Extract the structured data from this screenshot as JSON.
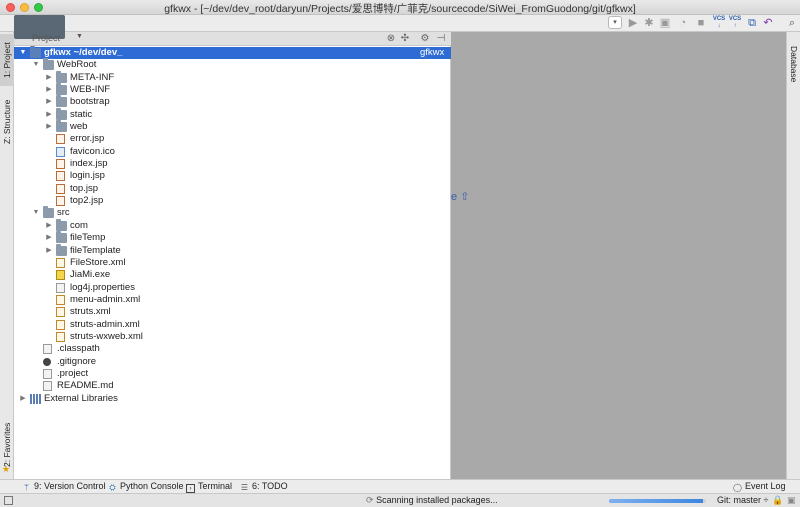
{
  "window": {
    "title": "gfkwx - [~/dev/dev_root/daryun/Projects/爱思博特/广菲克/sourcecode/SiWei_FromGuodong/git/gfkwx]"
  },
  "left_stripe": {
    "tabs": [
      {
        "label": "1: Project",
        "icon": "folder-icon"
      },
      {
        "label": "Z: Structure",
        "icon": "structure-icon"
      },
      {
        "label": "2: Favorites",
        "icon": "star-icon"
      }
    ]
  },
  "right_stripe": {
    "tabs": [
      {
        "label": "Database",
        "icon": "database-icon"
      }
    ]
  },
  "project_panel": {
    "header_label": "Project",
    "tree": [
      {
        "label": "gfkwx  ~/dev/dev_",
        "depth": 0,
        "arrow": "expanded",
        "icon": "folder-blue",
        "selected": true,
        "suffix": "gfkwx"
      },
      {
        "label": "WebRoot",
        "depth": 1,
        "arrow": "expanded",
        "icon": "folder"
      },
      {
        "label": "META-INF",
        "depth": 2,
        "arrow": "collapsed",
        "icon": "folder"
      },
      {
        "label": "WEB-INF",
        "depth": 2,
        "arrow": "collapsed",
        "icon": "folder"
      },
      {
        "label": "bootstrap",
        "depth": 2,
        "arrow": "collapsed",
        "icon": "folder"
      },
      {
        "label": "static",
        "depth": 2,
        "arrow": "collapsed",
        "icon": "folder"
      },
      {
        "label": "web",
        "depth": 2,
        "arrow": "collapsed",
        "icon": "folder"
      },
      {
        "label": "error.jsp",
        "depth": 2,
        "arrow": "none",
        "icon": "file-jsp"
      },
      {
        "label": "favicon.ico",
        "depth": 2,
        "arrow": "none",
        "icon": "file-ico"
      },
      {
        "label": "index.jsp",
        "depth": 2,
        "arrow": "none",
        "icon": "file-jsp"
      },
      {
        "label": "login.jsp",
        "depth": 2,
        "arrow": "none",
        "icon": "file-jsp"
      },
      {
        "label": "top.jsp",
        "depth": 2,
        "arrow": "none",
        "icon": "file-jsp"
      },
      {
        "label": "top2.jsp",
        "depth": 2,
        "arrow": "none",
        "icon": "file-jsp"
      },
      {
        "label": "src",
        "depth": 1,
        "arrow": "expanded",
        "icon": "folder"
      },
      {
        "label": "com",
        "depth": 2,
        "arrow": "collapsed",
        "icon": "folder"
      },
      {
        "label": "fileTemp",
        "depth": 2,
        "arrow": "collapsed",
        "icon": "folder"
      },
      {
        "label": "fileTemplate",
        "depth": 2,
        "arrow": "collapsed",
        "icon": "folder"
      },
      {
        "label": "FileStore.xml",
        "depth": 2,
        "arrow": "none",
        "icon": "file-xml"
      },
      {
        "label": "JiaMi.exe",
        "depth": 2,
        "arrow": "none",
        "icon": "file-exe"
      },
      {
        "label": "log4j.properties",
        "depth": 2,
        "arrow": "none",
        "icon": "file-gen"
      },
      {
        "label": "menu-admin.xml",
        "depth": 2,
        "arrow": "none",
        "icon": "file-xml"
      },
      {
        "label": "struts.xml",
        "depth": 2,
        "arrow": "none",
        "icon": "file-xml"
      },
      {
        "label": "struts-admin.xml",
        "depth": 2,
        "arrow": "none",
        "icon": "file-xml"
      },
      {
        "label": "struts-wxweb.xml",
        "depth": 2,
        "arrow": "none",
        "icon": "file-xml"
      },
      {
        "label": ".classpath",
        "depth": 1,
        "arrow": "none",
        "icon": "file-gen"
      },
      {
        "label": ".gitignore",
        "depth": 1,
        "arrow": "none",
        "icon": "file-git"
      },
      {
        "label": ".project",
        "depth": 1,
        "arrow": "none",
        "icon": "file-gen"
      },
      {
        "label": "README.md",
        "depth": 1,
        "arrow": "none",
        "icon": "file-gen"
      },
      {
        "label": "External Libraries",
        "depth": 0,
        "arrow": "collapsed",
        "icon": "lib"
      }
    ]
  },
  "editor": {
    "hint": "e ⇧"
  },
  "bottom_tools": [
    {
      "label": "9: Version Control",
      "icon": "version-control-icon"
    },
    {
      "label": "Python Console",
      "icon": "python-icon"
    },
    {
      "label": "Terminal",
      "icon": "terminal-icon"
    },
    {
      "label": "6: TODO",
      "icon": "todo-icon"
    },
    {
      "label": "Event Log",
      "icon": "event-log-icon"
    }
  ],
  "status_bar": {
    "message": "Scanning installed packages...",
    "progress": 0.97,
    "branch": "Git: master ÷"
  },
  "colors": {
    "selection": "#2f6bd5",
    "editor_bg": "#a9a9a9",
    "nav_chip": "#5a6774"
  }
}
